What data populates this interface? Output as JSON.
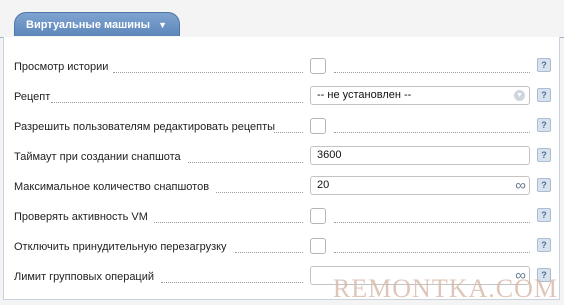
{
  "tab": {
    "label": "Виртуальные машины",
    "icon": "chevron-down-icon"
  },
  "rows": [
    {
      "label": "Просмотр истории",
      "control": "checkbox",
      "checked": false
    },
    {
      "label": "Рецепт",
      "control": "select",
      "value": "-- не установлен --"
    },
    {
      "label": "Разрешить пользователям редактировать рецепты",
      "control": "checkbox",
      "checked": false
    },
    {
      "label": "Таймаут при создании снапшота",
      "control": "text",
      "value": "3600"
    },
    {
      "label": "Максимальное количество снапшотов",
      "control": "number-infinite",
      "value": "20"
    },
    {
      "label": "Проверять активность VM",
      "control": "checkbox",
      "checked": false
    },
    {
      "label": "Отключить принудительную перезагрузку",
      "control": "checkbox",
      "checked": false
    },
    {
      "label": "Лимит групповых операций",
      "control": "number-infinite",
      "value": ""
    }
  ],
  "help_icon": "?",
  "watermark": "REMONTKA.COM",
  "colors": {
    "tab": "#6b91c3",
    "border": "#9fb3cc"
  }
}
